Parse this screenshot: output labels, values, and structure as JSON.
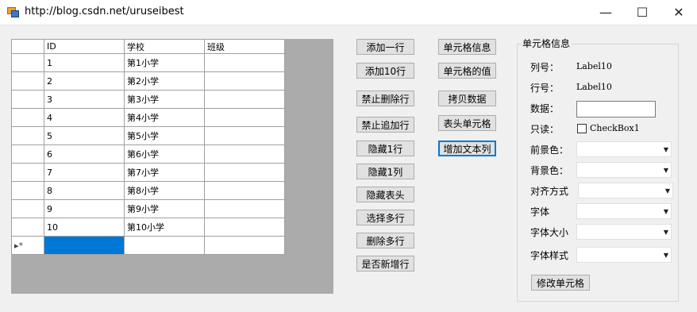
{
  "window": {
    "title": "http://blog.csdn.net/uruseibest",
    "min": "—",
    "max": "☐",
    "close": "✕"
  },
  "grid": {
    "headers": [
      "",
      "ID",
      "学校",
      "班级"
    ],
    "rows": [
      {
        "id": "1",
        "school": "第1小学"
      },
      {
        "id": "2",
        "school": "第2小学"
      },
      {
        "id": "3",
        "school": "第3小学"
      },
      {
        "id": "4",
        "school": "第4小学"
      },
      {
        "id": "5",
        "school": "第5小学"
      },
      {
        "id": "6",
        "school": "第6小学"
      },
      {
        "id": "7",
        "school": "第7小学"
      },
      {
        "id": "8",
        "school": "第8小学"
      },
      {
        "id": "9",
        "school": "第9小学"
      },
      {
        "id": "10",
        "school": "第10小学"
      }
    ],
    "new_row_marker": "▸*"
  },
  "buttons_col1": [
    "添加一行",
    "添加10行",
    "禁止删除行",
    "禁止追加行",
    "隐藏1行",
    "隐藏1列",
    "隐藏表头",
    "选择多行",
    "删除多行",
    "是否新增行"
  ],
  "buttons_col2": [
    "单元格信息",
    "单元格的值",
    "拷贝数据",
    "表头单元格",
    "增加文本列"
  ],
  "panel": {
    "title": "单元格信息",
    "col_label": "列号：",
    "col_value": "Label10",
    "row_label": "行号：",
    "row_value": "Label10",
    "data_label": "数据：",
    "readonly_label": "只读：",
    "checkbox_label": "CheckBox1",
    "fore_label": "前景色：",
    "back_label": "背景色：",
    "align_label": "对齐方式",
    "font_label": "字体",
    "size_label": "字体大小",
    "style_label": "字体样式",
    "modify_button": "修改单元格"
  }
}
